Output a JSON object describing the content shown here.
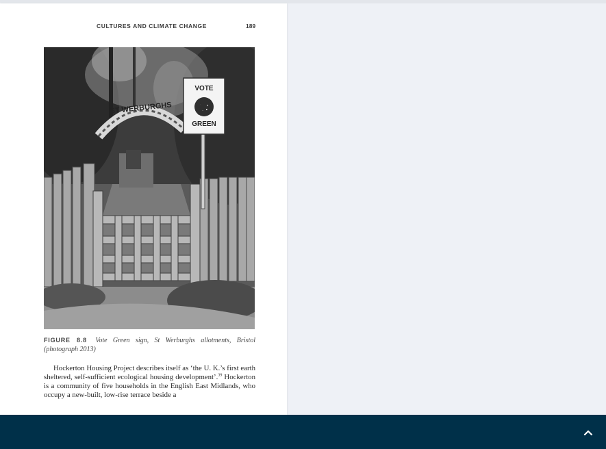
{
  "page": {
    "running_head": "CULTURES AND CLIMATE CHANGE",
    "page_number": "189",
    "figure": {
      "label": "FIGURE 8.8",
      "caption": "Vote Green sign, St Werburghs allotments, Bristol (photograph 2013)",
      "sign_line_1": "VOTE",
      "sign_line_2": "GREEN",
      "arch_text": "ST WERBURGHS"
    },
    "body": {
      "paragraph_text": "Hockerton Housing Project describes itself as ‘the U. K.’s first earth sheltered, self-sufficient ecological housing development’.",
      "footnote_ref": "39",
      "paragraph_cont": " Hockerton is a community of five households in the English East Midlands, who occupy a new-built, low-rise terrace beside a"
    }
  },
  "footer": {
    "scroll_top_icon": "chevron-up-icon",
    "color": "#003049"
  },
  "colors": {
    "viewer_background": "#eef1f6",
    "page_background": "#ffffff"
  }
}
